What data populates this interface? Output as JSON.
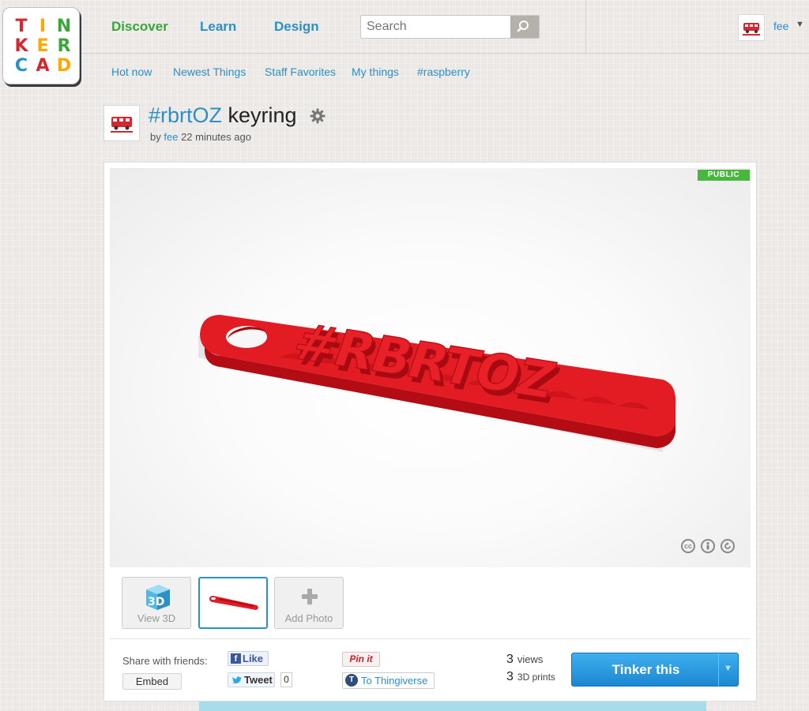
{
  "logo": {
    "letters": [
      "T",
      "I",
      "N",
      "K",
      "E",
      "R",
      "C",
      "A",
      "D"
    ],
    "colors": [
      "#d8262e",
      "#ffa600",
      "#3aa63a",
      "#d8262e",
      "#ffa600",
      "#3aa63a",
      "#2d8fc4",
      "#d8262e",
      "#ffa600"
    ]
  },
  "nav": {
    "discover": "Discover",
    "learn": "Learn",
    "design": "Design"
  },
  "search": {
    "placeholder": "Search"
  },
  "user": {
    "name": "fee"
  },
  "subnav": [
    "Hot now",
    "Newest Things",
    "Staff Favorites",
    "My things",
    "#raspberry"
  ],
  "thing": {
    "title_tag": "#rbrtOZ",
    "title_rest": " keyring",
    "by": "by",
    "author": "fee",
    "time": "22 minutes ago",
    "visibility": "PUBLIC"
  },
  "thumbs": {
    "view3d_icon": "3D",
    "view3d": "View 3D",
    "add_photo": "Add Photo"
  },
  "share": {
    "label": "Share with friends:",
    "embed": "Embed",
    "like": "Like",
    "tweet": "Tweet",
    "tweet_count": "0",
    "pin": "Pin it",
    "thingiverse": "To Thingiverse"
  },
  "stats": {
    "views_n": "3",
    "views": "views",
    "prints_n": "3",
    "prints": "3D prints"
  },
  "action": {
    "tinker": "Tinker this"
  },
  "colors": {
    "accent_blue": "#2d8fc4",
    "active_green": "#3aa63a",
    "model_red": "#e0161f",
    "public_badge": "#47b83d"
  }
}
